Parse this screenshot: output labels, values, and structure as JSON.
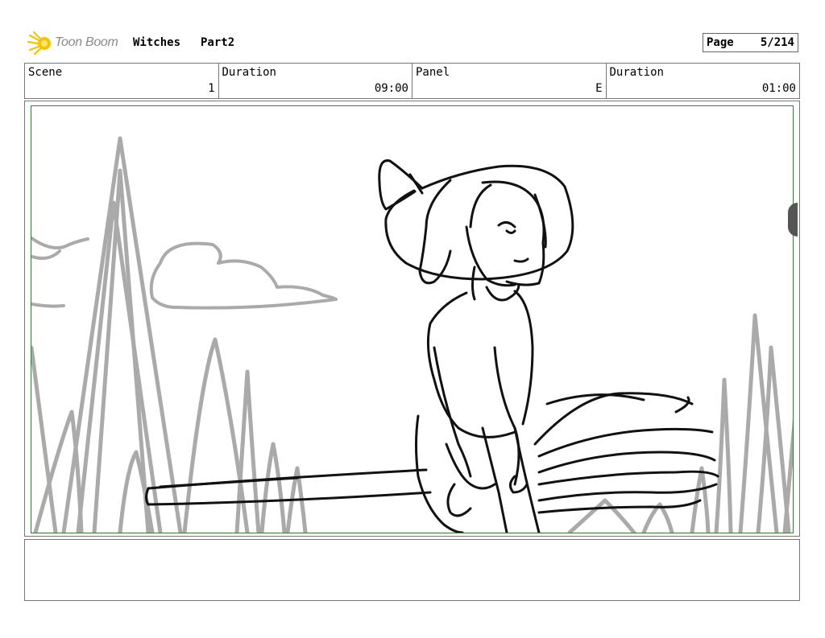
{
  "header": {
    "logo_text": "Toon Boom",
    "project_title": "Witches",
    "project_part": "Part2",
    "page_label": "Page",
    "page_value": "5/214"
  },
  "info": [
    {
      "label": "Scene",
      "value": "1"
    },
    {
      "label": "Duration",
      "value": "09:00"
    },
    {
      "label": "Panel",
      "value": "E"
    },
    {
      "label": "Duration",
      "value": "01:00"
    }
  ],
  "colors": {
    "panel_border": "#3d7a3d",
    "background_sketch": "#aaaaaa",
    "foreground_sketch": "#111111",
    "logo_yellow": "#f5c400"
  },
  "notes": ""
}
